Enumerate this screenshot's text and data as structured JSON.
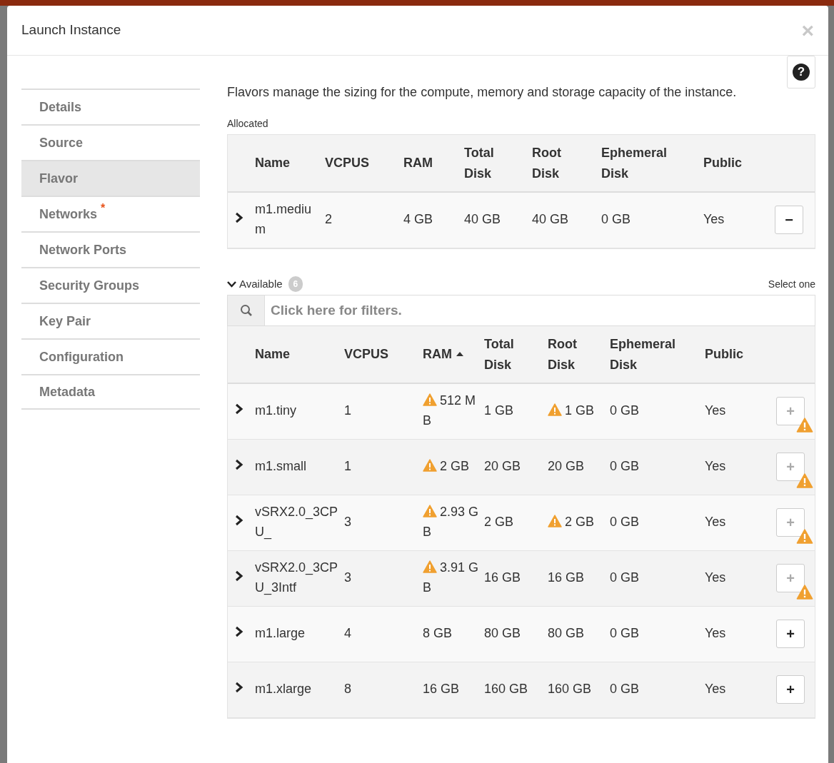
{
  "window": {
    "title": "Launch Instance",
    "close": "×"
  },
  "help": "?",
  "sidebar": {
    "items": [
      {
        "label": "Details",
        "selected": false
      },
      {
        "label": "Source",
        "selected": false
      },
      {
        "label": "Flavor",
        "selected": true
      },
      {
        "label": "Networks",
        "selected": false,
        "required_mark": "*"
      },
      {
        "label": "Network Ports",
        "selected": false
      },
      {
        "label": "Security Groups",
        "selected": false
      },
      {
        "label": "Key Pair",
        "selected": false
      },
      {
        "label": "Configuration",
        "selected": false
      },
      {
        "label": "Metadata",
        "selected": false
      }
    ]
  },
  "description": "Flavors manage the sizing for the compute, memory and storage capacity of the instance.",
  "allocated": {
    "label": "Allocated",
    "columns": [
      "Name",
      "VCPUS",
      "RAM",
      "Total Disk",
      "Root Disk",
      "Ephemeral Disk",
      "Public"
    ],
    "rows": [
      {
        "name": "m1.medium",
        "vcpus": "2",
        "ram": {
          "text": "4 GB",
          "warning": false
        },
        "total_disk": "40 GB",
        "root_disk": {
          "text": "40 GB",
          "warning": false
        },
        "ephemeral_disk": "0 GB",
        "public": "Yes",
        "action": {
          "label": "−",
          "warning": false
        }
      }
    ]
  },
  "available": {
    "label": "Available",
    "count": "6",
    "expanded": true,
    "hint": "Select one",
    "filter": {
      "placeholder": "Click here for filters."
    },
    "columns": [
      {
        "label": "Name",
        "sorted": false
      },
      {
        "label": "VCPUS",
        "sorted": false
      },
      {
        "label": "RAM",
        "sorted": true
      },
      {
        "label": "Total Disk",
        "sorted": false
      },
      {
        "label": "Root Disk",
        "sorted": false
      },
      {
        "label": "Ephemeral Disk",
        "sorted": false
      },
      {
        "label": "Public",
        "sorted": false
      }
    ],
    "rows": [
      {
        "name": "m1.tiny",
        "vcpus": "1",
        "ram": {
          "text": "512 MB",
          "warning": true
        },
        "total_disk": "1 GB",
        "root_disk": {
          "text": "1 GB",
          "warning": true
        },
        "ephemeral_disk": "0 GB",
        "public": "Yes",
        "action": {
          "label": "+",
          "warning": true
        }
      },
      {
        "name": "m1.small",
        "vcpus": "1",
        "ram": {
          "text": "2 GB",
          "warning": true
        },
        "total_disk": "20 GB",
        "root_disk": {
          "text": "20 GB",
          "warning": false
        },
        "ephemeral_disk": "0 GB",
        "public": "Yes",
        "action": {
          "label": "+",
          "warning": true
        }
      },
      {
        "name": "vSRX2.0_3CPU_",
        "vcpus": "3",
        "ram": {
          "text": "2.93 GB",
          "warning": true
        },
        "total_disk": "2 GB",
        "root_disk": {
          "text": "2 GB",
          "warning": true
        },
        "ephemeral_disk": "0 GB",
        "public": "Yes",
        "action": {
          "label": "+",
          "warning": true
        }
      },
      {
        "name": "vSRX2.0_3CPU_3Intf",
        "vcpus": "3",
        "ram": {
          "text": "3.91 GB",
          "warning": true
        },
        "total_disk": "16 GB",
        "root_disk": {
          "text": "16 GB",
          "warning": false
        },
        "ephemeral_disk": "0 GB",
        "public": "Yes",
        "action": {
          "label": "+",
          "warning": true
        }
      },
      {
        "name": "m1.large",
        "vcpus": "4",
        "ram": {
          "text": "8 GB",
          "warning": false
        },
        "total_disk": "80 GB",
        "root_disk": {
          "text": "80 GB",
          "warning": false
        },
        "ephemeral_disk": "0 GB",
        "public": "Yes",
        "action": {
          "label": "+",
          "warning": false
        }
      },
      {
        "name": "m1.xlarge",
        "vcpus": "8",
        "ram": {
          "text": "16 GB",
          "warning": false
        },
        "total_disk": "160 GB",
        "root_disk": {
          "text": "160 GB",
          "warning": false
        },
        "ephemeral_disk": "0 GB",
        "public": "Yes",
        "action": {
          "label": "+",
          "warning": false
        }
      }
    ]
  }
}
